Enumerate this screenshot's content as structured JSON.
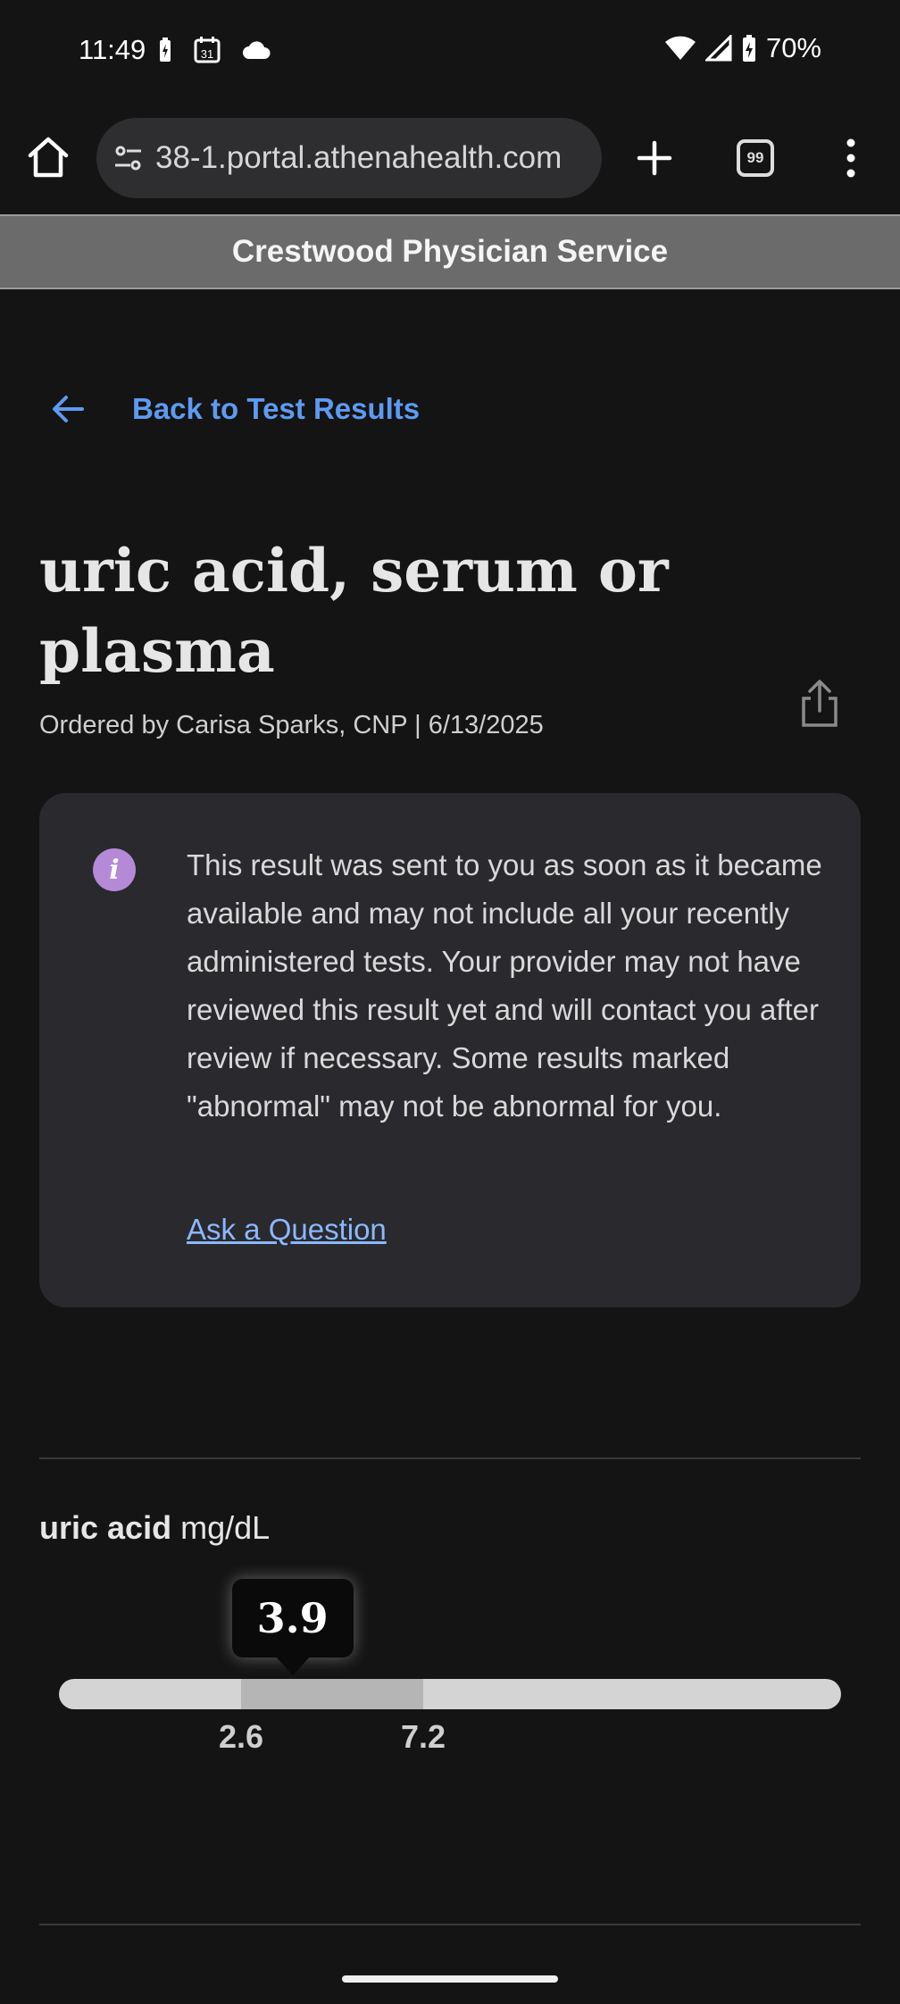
{
  "status_bar": {
    "time": "11:49",
    "battery_percent": "70%",
    "icons": [
      "battery-saver-icon",
      "calendar-icon",
      "cloud-icon",
      "wifi-icon",
      "signal-icon",
      "battery-charging-icon"
    ],
    "calendar_day": "31"
  },
  "browser": {
    "url": "38-1.portal.athenahealth.com",
    "tab_count": "99",
    "icons": [
      "home-icon",
      "site-settings-icon",
      "new-tab-icon",
      "tabs-icon",
      "more-menu-icon"
    ]
  },
  "banner": {
    "title": "Crestwood Physician Service"
  },
  "back_link": {
    "label": "Back to Test Results",
    "icon": "arrow-left-icon"
  },
  "result": {
    "title": "uric acid, serum or plasma",
    "ordered_by": "Ordered by Carisa Sparks, CNP | 6/13/2025",
    "share_icon": "share-icon"
  },
  "notice": {
    "icon": "info-icon",
    "icon_glyph": "i",
    "text": "This result was sent to you as soon as it became available and may not include all your recently administered tests. Your provider may not have reviewed this result yet and will contact you after review if necessary. Some results marked \"abnormal\" may not be abnormal for you.",
    "link": "Ask a Question"
  },
  "measurement": {
    "name": "uric acid",
    "unit": "mg/dL",
    "value": "3.9",
    "value_num": 3.9,
    "range_low": "2.6",
    "range_high": "7.2",
    "range_low_num": 2.6,
    "range_high_num": 7.2
  },
  "colors": {
    "link_blue": "#5d9bf2",
    "info_purple": "#b48ad8",
    "banner_gray": "#6b6b6b"
  }
}
